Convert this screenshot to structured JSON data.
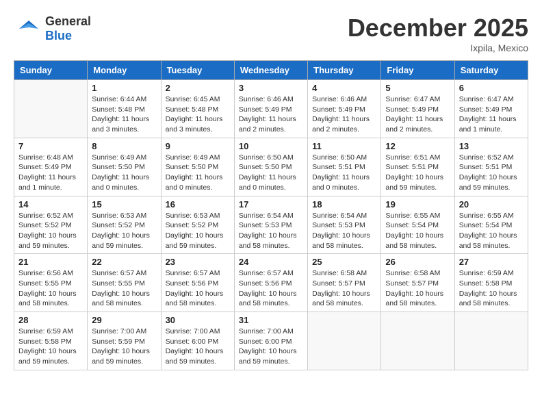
{
  "header": {
    "logo_general": "General",
    "logo_blue": "Blue",
    "month": "December 2025",
    "location": "Ixpila, Mexico"
  },
  "weekdays": [
    "Sunday",
    "Monday",
    "Tuesday",
    "Wednesday",
    "Thursday",
    "Friday",
    "Saturday"
  ],
  "weeks": [
    [
      {
        "day": "",
        "empty": true
      },
      {
        "day": "1",
        "sunrise": "Sunrise: 6:44 AM",
        "sunset": "Sunset: 5:48 PM",
        "daylight": "Daylight: 11 hours and 3 minutes."
      },
      {
        "day": "2",
        "sunrise": "Sunrise: 6:45 AM",
        "sunset": "Sunset: 5:48 PM",
        "daylight": "Daylight: 11 hours and 3 minutes."
      },
      {
        "day": "3",
        "sunrise": "Sunrise: 6:46 AM",
        "sunset": "Sunset: 5:49 PM",
        "daylight": "Daylight: 11 hours and 2 minutes."
      },
      {
        "day": "4",
        "sunrise": "Sunrise: 6:46 AM",
        "sunset": "Sunset: 5:49 PM",
        "daylight": "Daylight: 11 hours and 2 minutes."
      },
      {
        "day": "5",
        "sunrise": "Sunrise: 6:47 AM",
        "sunset": "Sunset: 5:49 PM",
        "daylight": "Daylight: 11 hours and 2 minutes."
      },
      {
        "day": "6",
        "sunrise": "Sunrise: 6:47 AM",
        "sunset": "Sunset: 5:49 PM",
        "daylight": "Daylight: 11 hours and 1 minute."
      }
    ],
    [
      {
        "day": "7",
        "sunrise": "Sunrise: 6:48 AM",
        "sunset": "Sunset: 5:49 PM",
        "daylight": "Daylight: 11 hours and 1 minute."
      },
      {
        "day": "8",
        "sunrise": "Sunrise: 6:49 AM",
        "sunset": "Sunset: 5:50 PM",
        "daylight": "Daylight: 11 hours and 0 minutes."
      },
      {
        "day": "9",
        "sunrise": "Sunrise: 6:49 AM",
        "sunset": "Sunset: 5:50 PM",
        "daylight": "Daylight: 11 hours and 0 minutes."
      },
      {
        "day": "10",
        "sunrise": "Sunrise: 6:50 AM",
        "sunset": "Sunset: 5:50 PM",
        "daylight": "Daylight: 11 hours and 0 minutes."
      },
      {
        "day": "11",
        "sunrise": "Sunrise: 6:50 AM",
        "sunset": "Sunset: 5:51 PM",
        "daylight": "Daylight: 11 hours and 0 minutes."
      },
      {
        "day": "12",
        "sunrise": "Sunrise: 6:51 AM",
        "sunset": "Sunset: 5:51 PM",
        "daylight": "Daylight: 10 hours and 59 minutes."
      },
      {
        "day": "13",
        "sunrise": "Sunrise: 6:52 AM",
        "sunset": "Sunset: 5:51 PM",
        "daylight": "Daylight: 10 hours and 59 minutes."
      }
    ],
    [
      {
        "day": "14",
        "sunrise": "Sunrise: 6:52 AM",
        "sunset": "Sunset: 5:52 PM",
        "daylight": "Daylight: 10 hours and 59 minutes."
      },
      {
        "day": "15",
        "sunrise": "Sunrise: 6:53 AM",
        "sunset": "Sunset: 5:52 PM",
        "daylight": "Daylight: 10 hours and 59 minutes."
      },
      {
        "day": "16",
        "sunrise": "Sunrise: 6:53 AM",
        "sunset": "Sunset: 5:52 PM",
        "daylight": "Daylight: 10 hours and 59 minutes."
      },
      {
        "day": "17",
        "sunrise": "Sunrise: 6:54 AM",
        "sunset": "Sunset: 5:53 PM",
        "daylight": "Daylight: 10 hours and 58 minutes."
      },
      {
        "day": "18",
        "sunrise": "Sunrise: 6:54 AM",
        "sunset": "Sunset: 5:53 PM",
        "daylight": "Daylight: 10 hours and 58 minutes."
      },
      {
        "day": "19",
        "sunrise": "Sunrise: 6:55 AM",
        "sunset": "Sunset: 5:54 PM",
        "daylight": "Daylight: 10 hours and 58 minutes."
      },
      {
        "day": "20",
        "sunrise": "Sunrise: 6:55 AM",
        "sunset": "Sunset: 5:54 PM",
        "daylight": "Daylight: 10 hours and 58 minutes."
      }
    ],
    [
      {
        "day": "21",
        "sunrise": "Sunrise: 6:56 AM",
        "sunset": "Sunset: 5:55 PM",
        "daylight": "Daylight: 10 hours and 58 minutes."
      },
      {
        "day": "22",
        "sunrise": "Sunrise: 6:57 AM",
        "sunset": "Sunset: 5:55 PM",
        "daylight": "Daylight: 10 hours and 58 minutes."
      },
      {
        "day": "23",
        "sunrise": "Sunrise: 6:57 AM",
        "sunset": "Sunset: 5:56 PM",
        "daylight": "Daylight: 10 hours and 58 minutes."
      },
      {
        "day": "24",
        "sunrise": "Sunrise: 6:57 AM",
        "sunset": "Sunset: 5:56 PM",
        "daylight": "Daylight: 10 hours and 58 minutes."
      },
      {
        "day": "25",
        "sunrise": "Sunrise: 6:58 AM",
        "sunset": "Sunset: 5:57 PM",
        "daylight": "Daylight: 10 hours and 58 minutes."
      },
      {
        "day": "26",
        "sunrise": "Sunrise: 6:58 AM",
        "sunset": "Sunset: 5:57 PM",
        "daylight": "Daylight: 10 hours and 58 minutes."
      },
      {
        "day": "27",
        "sunrise": "Sunrise: 6:59 AM",
        "sunset": "Sunset: 5:58 PM",
        "daylight": "Daylight: 10 hours and 58 minutes."
      }
    ],
    [
      {
        "day": "28",
        "sunrise": "Sunrise: 6:59 AM",
        "sunset": "Sunset: 5:58 PM",
        "daylight": "Daylight: 10 hours and 59 minutes."
      },
      {
        "day": "29",
        "sunrise": "Sunrise: 7:00 AM",
        "sunset": "Sunset: 5:59 PM",
        "daylight": "Daylight: 10 hours and 59 minutes."
      },
      {
        "day": "30",
        "sunrise": "Sunrise: 7:00 AM",
        "sunset": "Sunset: 6:00 PM",
        "daylight": "Daylight: 10 hours and 59 minutes."
      },
      {
        "day": "31",
        "sunrise": "Sunrise: 7:00 AM",
        "sunset": "Sunset: 6:00 PM",
        "daylight": "Daylight: 10 hours and 59 minutes."
      },
      {
        "day": "",
        "empty": true
      },
      {
        "day": "",
        "empty": true
      },
      {
        "day": "",
        "empty": true
      }
    ]
  ]
}
